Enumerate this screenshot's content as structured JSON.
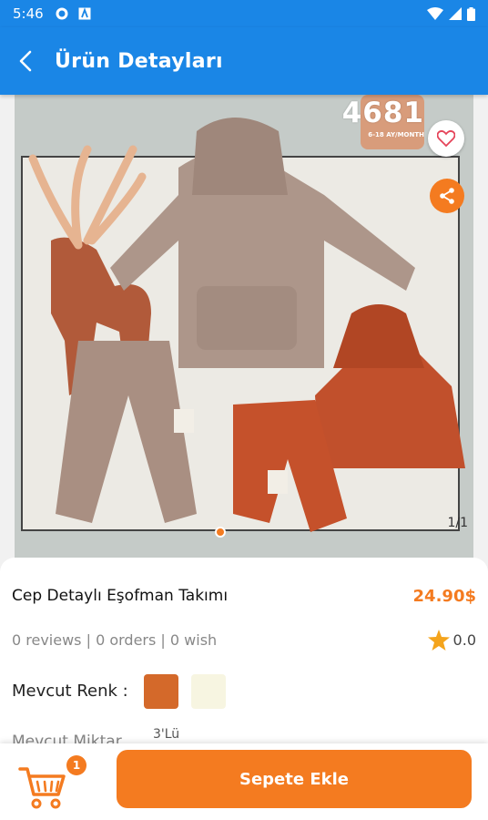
{
  "status_bar": {
    "time": "5:46"
  },
  "app_bar": {
    "title": "Ürün Detayları"
  },
  "gallery": {
    "brand_number": "4681",
    "brand_subtitle": "6-18 AY/MONTH",
    "counter": "1/1"
  },
  "product": {
    "name": "Cep Detaylı Eşofman Takımı",
    "price": "24.90$",
    "stats": "0 reviews | 0 orders | 0 wish",
    "rating": "0.0"
  },
  "colors": {
    "label": "Mevcut Renk :",
    "swatches": [
      "#d4692a",
      "#f7f5e1"
    ]
  },
  "quantity": {
    "label": "Mevcut Miktar",
    "value": "3'Lü"
  },
  "bottom": {
    "cart_count": "1",
    "add_button": "Sepete Ekle"
  },
  "theme": {
    "primary": "#1a86e6",
    "accent": "#f47b20"
  }
}
